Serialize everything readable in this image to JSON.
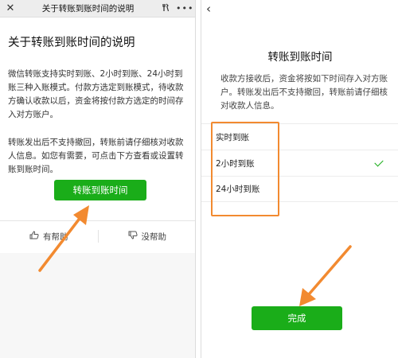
{
  "left": {
    "title_bar": {
      "title": "关于转账到账时间的说明",
      "close_icon": "close-icon",
      "tool_icon": "wrench-icon",
      "more_icon": "more-icon"
    },
    "heading": "关于转账到账时间的说明",
    "paragraph1": "微信转账支持实时到账、2小时到账、24小时到账三种入账模式。付款方选定到账模式，待收款方确认收款以后，资金将按付款方选定的时间存入对方账户。",
    "paragraph2": "转账发出后不支持撤回，转账前请仔细核对收款人信息。如您有需要，可点击下方查看或设置转账到账时间。",
    "button_label": "转账到账时间",
    "feedback": {
      "helpful": "有帮助",
      "not_helpful": "没帮助"
    }
  },
  "right": {
    "back_icon": "back-icon",
    "title": "转账到账时间",
    "description": "收款方接收后，资金将按如下时间存入对方账户。转账发出后不支持撤回，转账前请仔细核对收款人信息。",
    "options": [
      {
        "label": "实时到账",
        "selected": false
      },
      {
        "label": "2小时到账",
        "selected": true
      },
      {
        "label": "24小时到账",
        "selected": false
      }
    ],
    "done_label": "完成"
  },
  "colors": {
    "accent_green": "#1aad19",
    "annotation_orange": "#f28a30"
  }
}
